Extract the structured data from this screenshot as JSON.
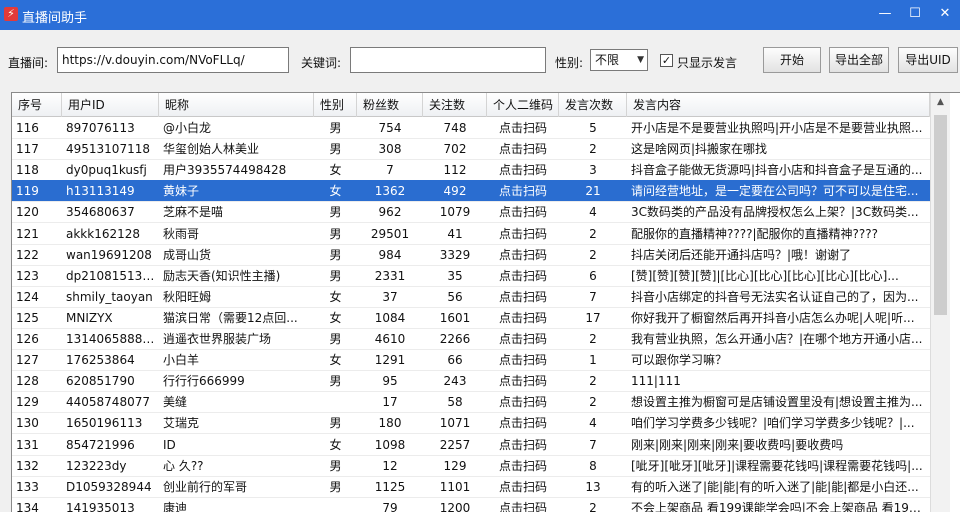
{
  "window": {
    "title": "直播间助手",
    "minimize": "—",
    "maximize": "☐",
    "close": "✕"
  },
  "toolbar": {
    "room_label": "直播间:",
    "room_value": "https://v.douyin.com/NVoFLLq/",
    "keyword_label": "关键词:",
    "keyword_value": "",
    "gender_label": "性别:",
    "gender_value": "不限",
    "only_speak_label": "只显示发言",
    "only_speak_checked": "✓",
    "start_label": "开始",
    "export_all_label": "导出全部",
    "export_uid_label": "导出UID"
  },
  "table": {
    "columns": [
      "序号",
      "用户ID",
      "昵称",
      "性别",
      "粉丝数",
      "关注数",
      "个人二维码",
      "发言次数",
      "发言内容"
    ],
    "selected_index": 3,
    "rows": [
      [
        "116",
        "897076113",
        "@小白龙",
        "男",
        "754",
        "748",
        "点击扫码",
        "5",
        "开小店是不是要营业执照吗|开小店是不是要营业执照..."
      ],
      [
        "117",
        "49513107118",
        "华玺创始人林美业",
        "男",
        "308",
        "702",
        "点击扫码",
        "2",
        "这是啥网页|抖搬家在哪找"
      ],
      [
        "118",
        "dy0puq1kusfj",
        "用户3935574498428",
        "女",
        "7",
        "112",
        "点击扫码",
        "3",
        "抖音盒子能做无货源吗|抖音小店和抖音盒子是互通的..."
      ],
      [
        "119",
        "h13113149",
        "黄妹子",
        "女",
        "1362",
        "492",
        "点击扫码",
        "21",
        "请问经营地址，是一定要在公司吗？可不可以是住宅..."
      ],
      [
        "120",
        "354680637",
        "芝麻不是喵",
        "男",
        "962",
        "1079",
        "点击扫码",
        "4",
        "3C数码类的产品没有品牌授权怎么上架？|3C数码类..."
      ],
      [
        "121",
        "akkk162128",
        "秋雨哥",
        "男",
        "29501",
        "41",
        "点击扫码",
        "2",
        "配服你的直播精神????|配服你的直播精神????"
      ],
      [
        "122",
        "wan19691208",
        "成哥山货",
        "男",
        "984",
        "3329",
        "点击扫码",
        "2",
        "抖店关闭后还能开通抖店吗？|哦！谢谢了"
      ],
      [
        "123",
        "dp210815131...",
        "励志天香(知识性主播)",
        "男",
        "2331",
        "35",
        "点击扫码",
        "6",
        "[赞][赞][赞][赞]|[比心][比心][比心][比心][比心]..."
      ],
      [
        "124",
        "shmily_taoyan",
        "秋阳旺姆",
        "女",
        "37",
        "56",
        "点击扫码",
        "7",
        "抖音小店绑定的抖音号无法实名认证自己的了，因为..."
      ],
      [
        "125",
        "MNIZYX",
        "猫滨日常（需要12点回...",
        "女",
        "1084",
        "1601",
        "点击扫码",
        "17",
        "你好我开了橱窗然后再开抖音小店怎么办呢|人呢|听..."
      ],
      [
        "126",
        "13140658889...",
        "逍遥衣世界服装广场",
        "男",
        "4610",
        "2266",
        "点击扫码",
        "2",
        "我有营业执照，怎么开通小店？|在哪个地方开通小店..."
      ],
      [
        "127",
        "176253864",
        "小白羊",
        "女",
        "1291",
        "66",
        "点击扫码",
        "1",
        "可以跟你学习嘛？"
      ],
      [
        "128",
        "620851790",
        "行行行666999",
        "男",
        "95",
        "243",
        "点击扫码",
        "2",
        "111|111"
      ],
      [
        "129",
        "44058748077",
        "美缝",
        "",
        "17",
        "58",
        "点击扫码",
        "2",
        "想设置主推为橱窗可是店铺设置里没有|想设置主推为..."
      ],
      [
        "130",
        "1650196113",
        "艾瑞克",
        "男",
        "180",
        "1071",
        "点击扫码",
        "4",
        "咱们学习学费多少钱呢？|咱们学习学费多少钱呢？|..."
      ],
      [
        "131",
        "854721996",
        "ID",
        "女",
        "1098",
        "2257",
        "点击扫码",
        "7",
        "刚来|刚来|刚来|刚来|要收费吗|要收费吗"
      ],
      [
        "132",
        "123223dy",
        "心 久??",
        "男",
        "12",
        "129",
        "点击扫码",
        "8",
        "[呲牙][呲牙][呲牙]|课程需要花钱吗|课程需要花钱吗|..."
      ],
      [
        "133",
        "D1059328944",
        "创业前行的军哥",
        "男",
        "1125",
        "1101",
        "点击扫码",
        "13",
        "有的听入迷了|能|能|有的听入迷了|能|能|都是小白还..."
      ],
      [
        "134",
        "141935013",
        "康迪",
        "",
        "79",
        "1200",
        "点击扫码",
        "2",
        "不会上架商品 看199课能学会吗|不会上架商品 看199..."
      ]
    ]
  }
}
